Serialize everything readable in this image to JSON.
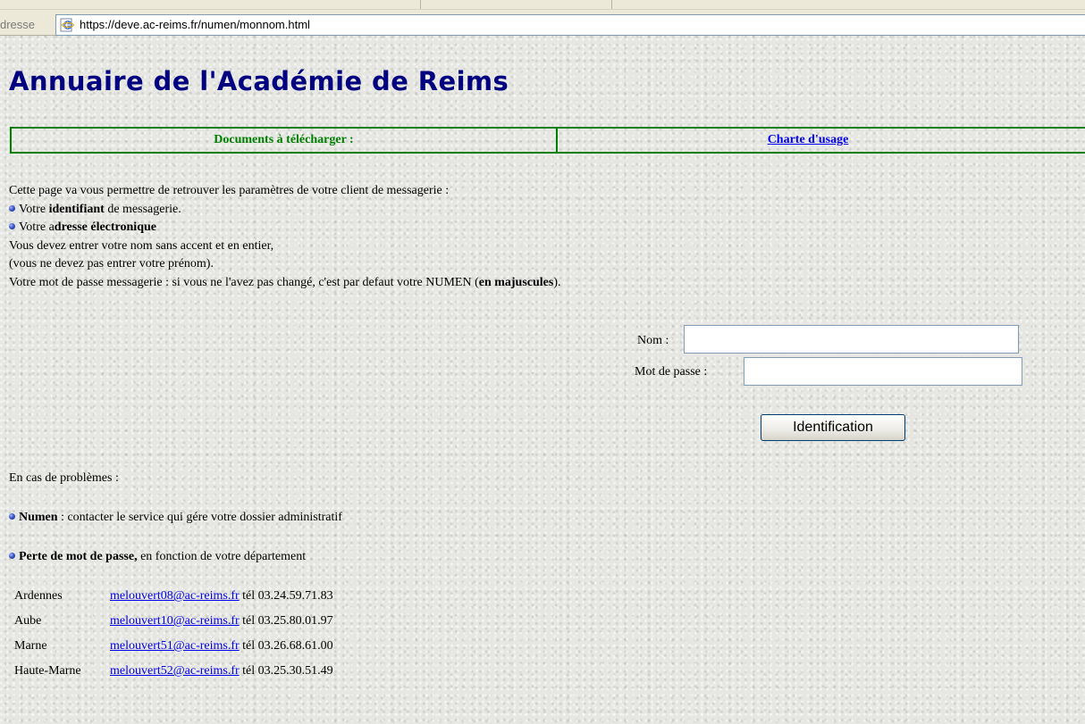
{
  "browser": {
    "address_label": "dresse",
    "url": "https://deve.ac-reims.fr/numen/monnom.html",
    "icon": "ie-page-icon"
  },
  "page": {
    "title": "Annuaire de l'Académie de Reims"
  },
  "documents_bar": {
    "left_label": "Documents à télécharger :",
    "right_link": "Charte d'usage "
  },
  "intro": {
    "line1": "Cette page va vous permettre de retrouver les paramètres de votre client de messagerie :",
    "item1_pre": "Votre ",
    "item1_bold": "identifiant",
    "item1_post": " de messagerie.",
    "item2_pre": "Votre a",
    "item2_bold": "dresse électronique",
    "line4": "Vous devez entrer votre nom sans accent et en entier,",
    "line5": "(vous ne devez pas entrer votre prénom).",
    "line6_pre": "Votre mot de passe messagerie : si vous ne l'avez pas changé, c'est par defaut votre NUMEN (",
    "line6_bold": "en majuscules",
    "line6_post": ")."
  },
  "form": {
    "nom_label": "Nom :",
    "nom_value": "",
    "password_label": "Mot de passe :",
    "password_value": "",
    "submit_label": "Identification"
  },
  "problems": {
    "heading": "En cas de problèmes :",
    "numen_bold": "Numen",
    "numen_text": " : contacter le service qui gére votre dossier administratif",
    "lost_bold": "Perte de mot de passe,",
    "lost_text": " en fonction de votre département",
    "contacts": [
      {
        "dept": "Ardennes",
        "email": "melouvert08@ac-reims.fr",
        "phone": " tél 03.24.59.71.83"
      },
      {
        "dept": "Aube",
        "email": "melouvert10@ac-reims.fr",
        "phone": " tél 03.25.80.01.97"
      },
      {
        "dept": "Marne",
        "email": "melouvert51@ac-reims.fr",
        "phone": " tél 03.26.68.61.00"
      },
      {
        "dept": "Haute-Marne",
        "email": "melouvert52@ac-reims.fr",
        "phone": " tél 03.25.30.51.49"
      }
    ]
  },
  "colors": {
    "title": "#000080",
    "table_border": "#008000",
    "link": "#0000ee"
  }
}
